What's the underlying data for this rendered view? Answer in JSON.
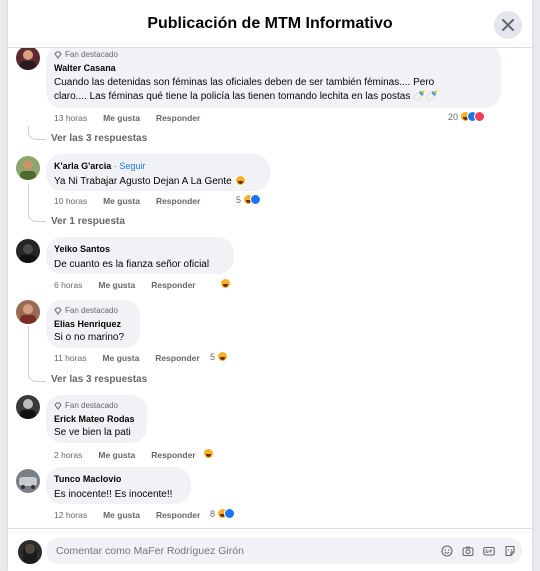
{
  "header": {
    "title": "Publicación de MTM Informativo"
  },
  "labels": {
    "fan_badge": "Fan destacado",
    "like": "Me gusta",
    "reply": "Responder"
  },
  "comments": [
    {
      "author": "Walter Casana",
      "body_lines": [
        "Cuando las detenidas son féminas las oficiales deben de ser también féminas.... Pero",
        "claro.... Las féminas qué tiene la policía las tienen tomando lechita en las postas 🍼🍼"
      ],
      "time": "13 horas",
      "reactions_count": "20",
      "replies": "Ver las 3 respuestas"
    },
    {
      "author": "K'arla G'arcia",
      "follow": "· Seguir",
      "body": "Ya Ni Trabajar Agusto Dejan A La Gente",
      "time": "10 horas",
      "reactions_count": "5",
      "replies": "Ver 1 respuesta"
    },
    {
      "author": "Yeiko Santos",
      "body": "De cuanto es la fianza señor oficial",
      "time": "6 horas"
    },
    {
      "author": "Elias Henriquez",
      "body": "Si o no marino?",
      "time": "11 horas",
      "reactions_count": "5",
      "replies": "Ver las 3 respuestas"
    },
    {
      "author": "Erick Mateo Rodas",
      "body": "Se ve bien la pati",
      "time": "2 horas"
    },
    {
      "author": "Tunco Maclovio",
      "body": "Es inocente!! Es inocente!!",
      "time": "12 horas",
      "reactions_count": "8"
    }
  ],
  "footer": {
    "placeholder": "Comentar como MaFer Rodríguez Girón"
  },
  "colors": {
    "link": "#1877f2",
    "bubble": "#f0f2f5",
    "muted": "#65676b"
  },
  "icons": [
    "close-icon",
    "diamond-icon",
    "haha-reaction-icon",
    "like-reaction-icon",
    "love-reaction-icon",
    "emoji-icon",
    "camera-icon",
    "gif-icon",
    "sticker-icon"
  ]
}
